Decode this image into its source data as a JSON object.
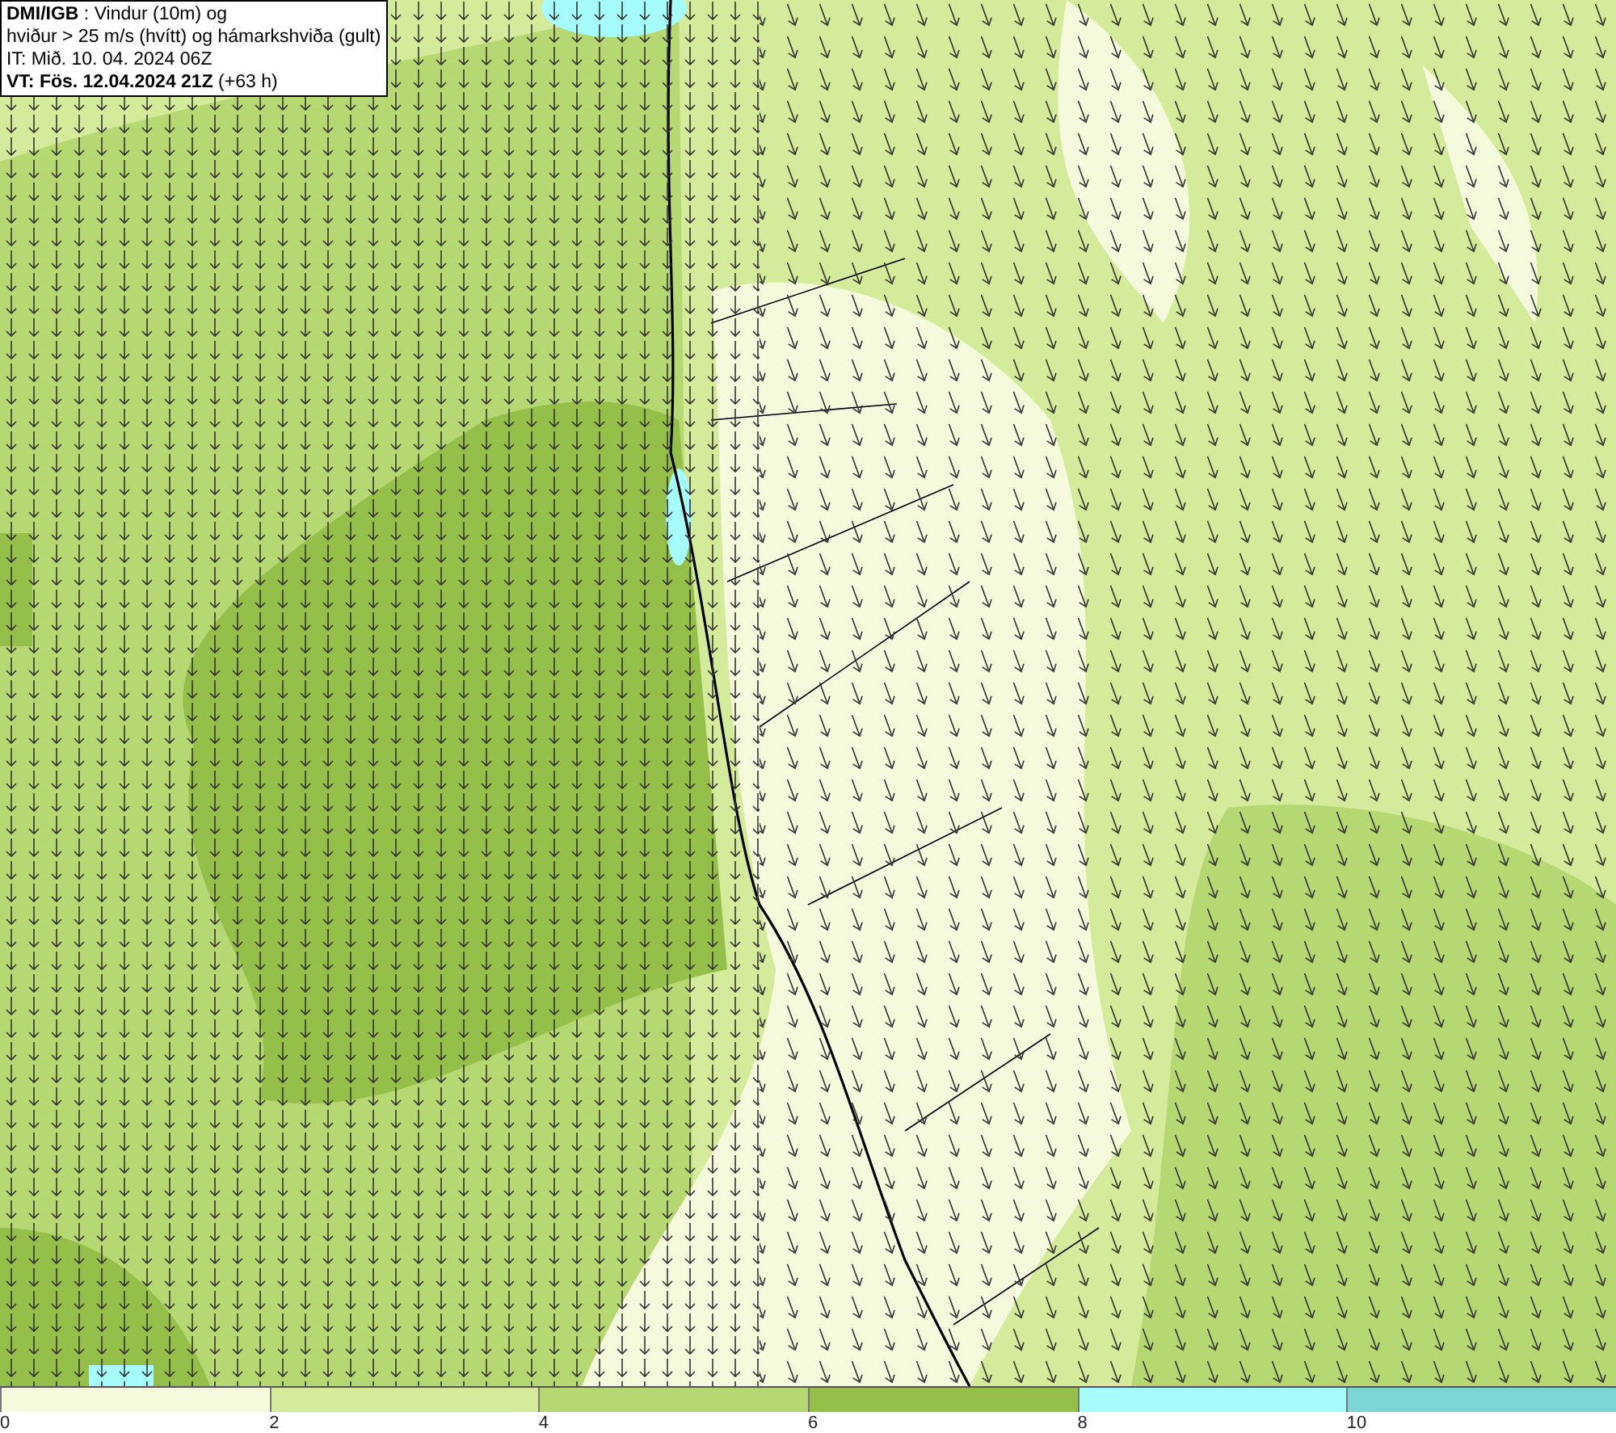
{
  "info_box": {
    "lines": [
      "**DMI/IGB** : Vindur (10m) og",
      "hviður > 25 m/s (hvítt) og hámarkshviða (gult)",
      "IT: Mið. 10. 04. 2024 06Z",
      "**VT: Fös. 12.04.2024 21Z** (+63 h)"
    ]
  },
  "legend": {
    "segments": [
      {
        "label": "0",
        "color": "#f5fadc"
      },
      {
        "label": "2",
        "color": "#d4eb9c"
      },
      {
        "label": "4",
        "color": "#b5d873"
      },
      {
        "label": "6",
        "color": "#94c04a"
      },
      {
        "label": "8",
        "color": "#a6fbfb"
      },
      {
        "label": "10",
        "color": "#7dd4d4"
      }
    ]
  }
}
